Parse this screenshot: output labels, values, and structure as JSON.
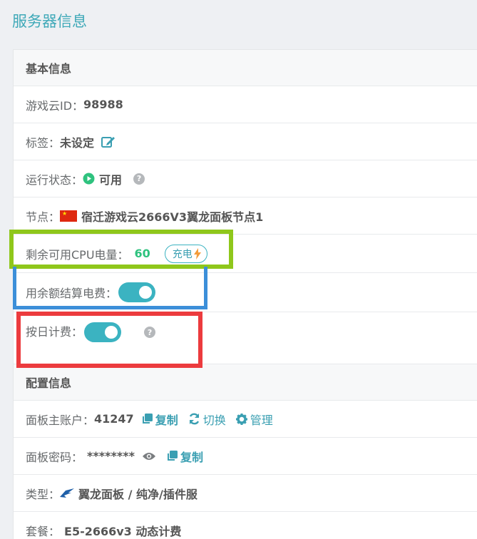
{
  "page_title": "服务器信息",
  "basic_section": {
    "title": "基本信息"
  },
  "game_cloud_id": {
    "label": "游戏云ID：",
    "value": "98988"
  },
  "tag": {
    "label": "标签：",
    "value": "未设定"
  },
  "run_status": {
    "label": "运行状态：",
    "value": "可用"
  },
  "node": {
    "label": "节点：",
    "value": "宿迁游戏云2666V3翼龙面板节点1"
  },
  "cpu_power": {
    "label": "剩余可用CPU电量：",
    "value": "60",
    "charge_label": "充电"
  },
  "balance_settle": {
    "label": "用余额结算电费：",
    "enabled": true
  },
  "daily_billing": {
    "label": "按日计费：",
    "enabled": true
  },
  "config_section": {
    "title": "配置信息"
  },
  "panel_account": {
    "label": "面板主账户：",
    "value": "41247",
    "copy_label": "复制",
    "switch_label": "切换",
    "manage_label": "管理"
  },
  "panel_password": {
    "label": "面板密码：",
    "value": "********",
    "copy_label": "复制"
  },
  "type": {
    "label": "类型：",
    "value": "翼龙面板 / 纯净/插件服"
  },
  "plan": {
    "label": "套餐：",
    "value": "E5-2666v3 动态计费"
  },
  "colors": {
    "accent": "#3a9fb2",
    "green": "#2ec27e",
    "highlight_green": "#8fc71b",
    "highlight_blue": "#3c8fd9",
    "highlight_red": "#ec3b3e"
  }
}
